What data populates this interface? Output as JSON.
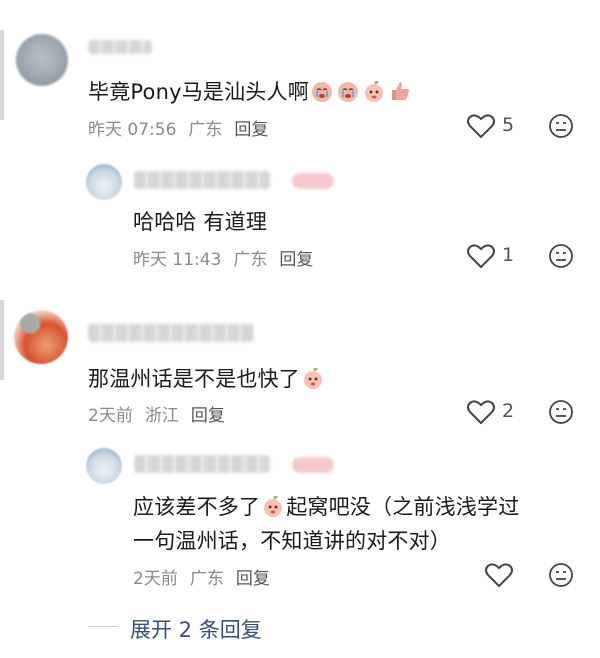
{
  "comments": [
    {
      "text": "毕竟Pony马是汕头人啊",
      "date": "昨天 07:56",
      "location": "广东",
      "reply_label": "回复",
      "likes": "5"
    },
    {
      "text": "哈哈哈 有道理",
      "date": "昨天 11:43",
      "location": "广东",
      "reply_label": "回复",
      "likes": "1"
    },
    {
      "text": "那温州话是不是也快了",
      "date": "2天前",
      "location": "浙江",
      "reply_label": "回复",
      "likes": "2"
    },
    {
      "text_line1_a": "应该差不多了",
      "text_line1_b": "起窝吧没（之前浅浅学过",
      "text_line2": "一句温州话，不知道讲的对不对）",
      "date": "2天前",
      "location": "广东",
      "reply_label": "回复",
      "likes": ""
    }
  ],
  "expand_replies": "展开 2 条回复",
  "icons": {
    "like": "heart-outline-icon",
    "dislike": "unhappy-face-icon",
    "emoji": "crying-face-emoji"
  },
  "colors": {
    "text": "#1a1a1a",
    "meta": "#8a8a8a",
    "link": "#3a4e7a",
    "author_tag": "#f7c9cf"
  }
}
